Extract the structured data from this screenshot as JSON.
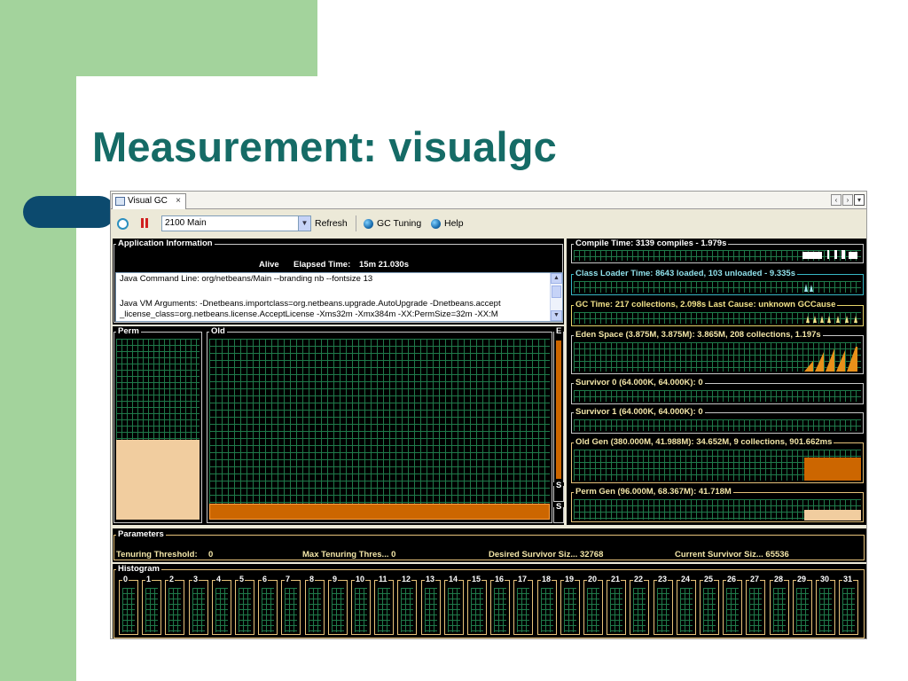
{
  "slide": {
    "title": "Measurement: visualgc"
  },
  "window": {
    "tab_label": "Visual GC",
    "tab_close": "×",
    "nav": {
      "left": "‹",
      "right": "›",
      "menu": "▾"
    }
  },
  "toolbar": {
    "process_select": "2100 Main",
    "refresh_label": "Refresh",
    "gc_tuning_label": "GC Tuning",
    "help_label": "Help"
  },
  "app_info": {
    "title": "Application Information",
    "status": "Alive",
    "elapsed_label": "Elapsed Time:",
    "elapsed_value": "15m 21.030s",
    "command_line": "Java Command Line: org/netbeans/Main --branding nb --fontsize 13",
    "vm_args_1": "Java VM Arguments: -Dnetbeans.importclass=org.netbeans.upgrade.AutoUpgrade -Dnetbeans.accept",
    "vm_args_2": "_license_class=org.netbeans.license.AcceptLicense -Xms32m -Xmx384m -XX:PermSize=32m -XX:M"
  },
  "spaces": {
    "perm_label": "Perm",
    "old_label": "Old",
    "eden_short": "E",
    "s0_short": "S",
    "s1_short": "S",
    "perm_fill_fraction": 0.44,
    "old_fill_fraction": 0.09
  },
  "graphs": {
    "compile_time": "Compile Time: 3139 compiles - 1.979s",
    "class_loader": "Class Loader Time: 8643 loaded, 103 unloaded - 9.335s",
    "gc_time": "GC Time: 217 collections, 2.098s  Last Cause: unknown GCCause",
    "eden_space": "Eden Space (3.875M, 3.875M): 3.865M, 208 collections, 1.197s",
    "survivor_0": "Survivor 0 (64.000K, 64.000K): 0",
    "survivor_1": "Survivor 1 (64.000K, 64.000K): 0",
    "old_gen": "Old Gen (380.000M, 41.988M): 34.652M, 9 collections, 901.662ms",
    "perm_gen": "Perm Gen (96.000M, 68.367M): 41.718M"
  },
  "parameters": {
    "title": "Parameters",
    "tenuring_threshold_label": "Tenuring Threshold:",
    "tenuring_threshold_value": "0",
    "max_tenuring": "Max Tenuring Thres... 0",
    "desired_survivor": "Desired Survivor Siz... 32768",
    "current_survivor": "Current Survivor Siz... 65536"
  },
  "histogram": {
    "title": "Histogram",
    "bins": [
      "0",
      "1",
      "2",
      "3",
      "4",
      "5",
      "6",
      "7",
      "8",
      "9",
      "10",
      "11",
      "12",
      "13",
      "14",
      "15",
      "16",
      "17",
      "18",
      "19",
      "20",
      "21",
      "22",
      "23",
      "24",
      "25",
      "26",
      "27",
      "28",
      "29",
      "30",
      "31"
    ]
  },
  "colors": {
    "title_teal": "#156b66",
    "side_green": "#a3d39c",
    "pill_navy": "#0c4a6e",
    "grid_green": "#1f7a4a",
    "old_orange": "#cc6600",
    "perm_beige": "#f1cd9f"
  }
}
